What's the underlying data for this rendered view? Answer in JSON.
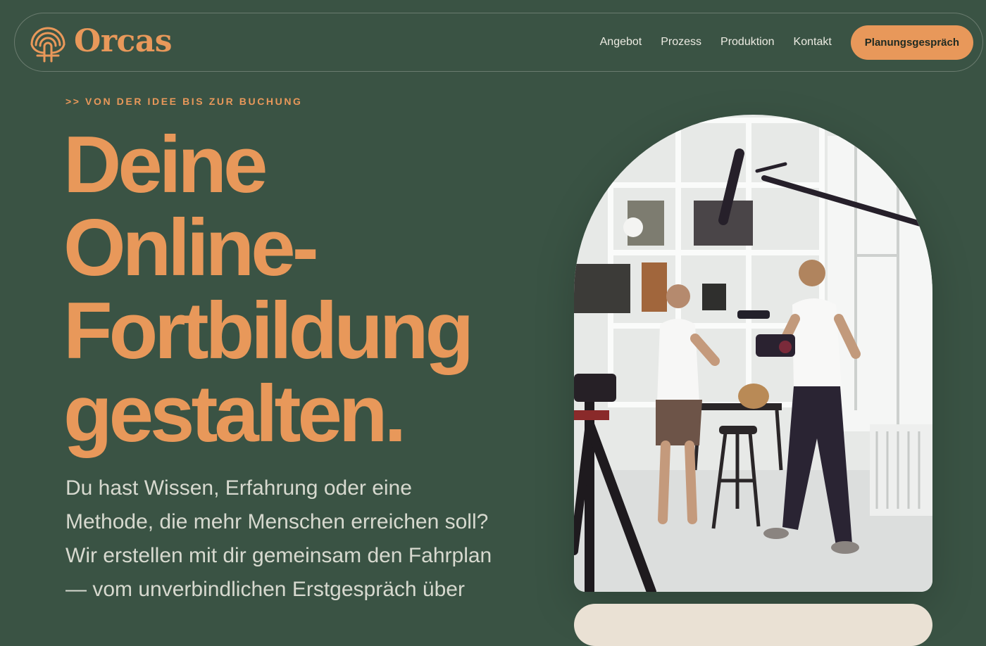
{
  "header": {
    "logo_text": "Orcas",
    "nav": [
      "Angebot",
      "Prozess",
      "Produktion",
      "Kontakt"
    ],
    "cta_label": "Planungsgespräch"
  },
  "hero": {
    "eyebrow": ">> VON DER IDEE BIS ZUR BUCHUNG",
    "headline_lines": [
      "Deine",
      "Online-",
      "Fortbildung",
      "gestalten."
    ],
    "intro_lines": [
      "Du hast Wissen, Erfahrung oder eine",
      "Methode, die mehr Menschen erreichen soll?",
      "Wir erstellen mit dir gemeinsam den Fahrplan",
      "— vom unverbindlichen Erstgespräch über"
    ],
    "image_icon": "video-production-photo"
  },
  "colors": {
    "background": "#3a5344",
    "accent": "#e8985a",
    "text_light": "#d7d9cf",
    "nav_text": "#ecebe2",
    "card": "#eae1d4"
  }
}
